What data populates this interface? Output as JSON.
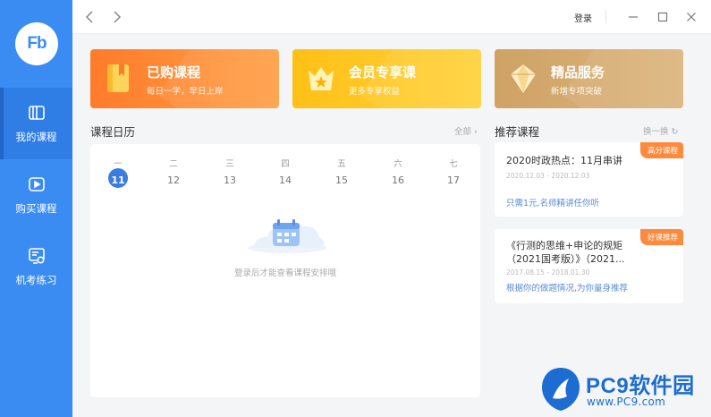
{
  "app": {
    "logo_text": "Fb"
  },
  "sidebar": {
    "items": [
      {
        "label": "我的课程",
        "icon": "book-icon",
        "active": true
      },
      {
        "label": "购买课程",
        "icon": "play-icon",
        "active": false
      },
      {
        "label": "机考练习",
        "icon": "exam-icon",
        "active": false
      }
    ]
  },
  "titlebar": {
    "login_label": "登录"
  },
  "cards": [
    {
      "title": "已购课程",
      "subtitle": "每日一学，早日上岸",
      "icon": "book-icon",
      "color": "#ff8533"
    },
    {
      "title": "会员专享课",
      "subtitle": "更多专享权益",
      "icon": "crown-icon",
      "color": "#ffc31f"
    },
    {
      "title": "精品服务",
      "subtitle": "新增专项突破",
      "icon": "diamond-icon",
      "color": "#d4a96e"
    }
  ],
  "calendar": {
    "title": "课程日历",
    "all_label": "全部",
    "weekdays": [
      "一",
      "二",
      "三",
      "四",
      "五",
      "六",
      "七"
    ],
    "days": [
      "11",
      "12",
      "13",
      "14",
      "15",
      "16",
      "17"
    ],
    "today_index": 0,
    "empty_text": "登录后才能查看课程安排哦"
  },
  "recommend": {
    "title": "推荐课程",
    "refresh_label": "换一换",
    "items": [
      {
        "badge": "高分课程",
        "title_lines": [
          "2020时政热点：11月串讲"
        ],
        "date": "2020.12.03 - 2020.12.03",
        "desc": "只需1元,名师精讲任你听"
      },
      {
        "badge": "好课推荐",
        "title_lines": [
          "《行测的思维+申论的规矩",
          "（2021国考版）》（2021..."
        ],
        "date": "2017.08.15 - 2018.01.30",
        "desc": "根据你的做题情况,为你量身推荐"
      }
    ]
  },
  "watermark": {
    "title": "PC9软件园",
    "url": "www.PC9.com"
  }
}
